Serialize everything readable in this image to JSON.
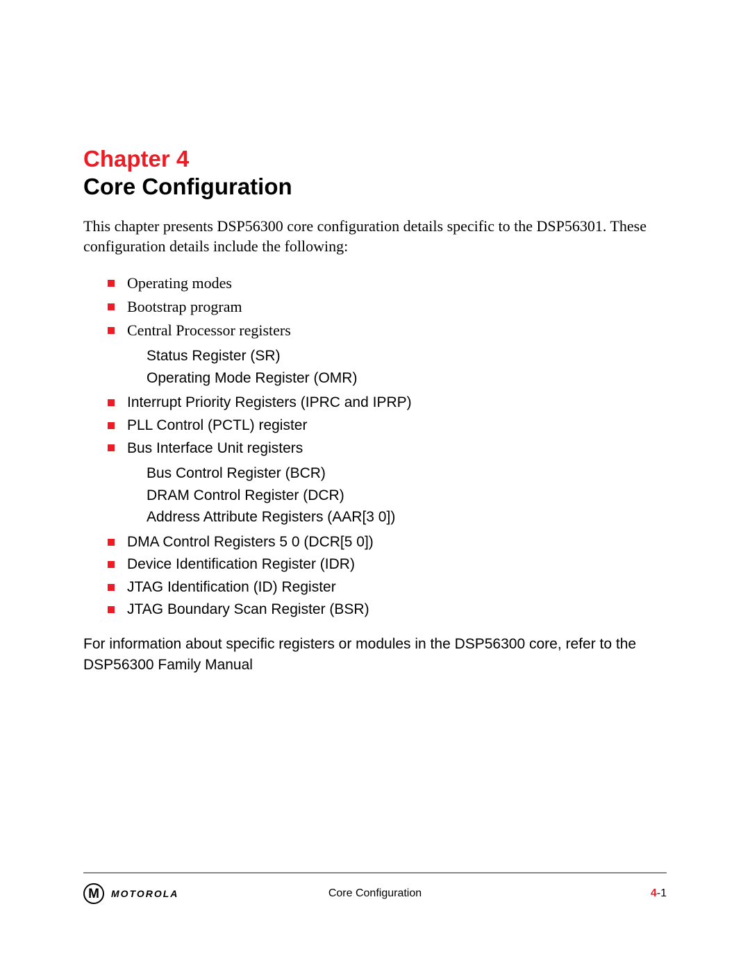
{
  "header": {
    "chapter_label": "Chapter 4",
    "chapter_title": "Core Configuration"
  },
  "intro": "This chapter presents DSP56300 core configuration details specific to the DSP56301. These configuration details include the following:",
  "bullets": [
    {
      "text": "Operating modes",
      "style": "serif",
      "sub": []
    },
    {
      "text": "Bootstrap program",
      "style": "serif",
      "sub": []
    },
    {
      "text": "Central Processor registers",
      "style": "serif",
      "sub": [
        "Status Register (SR)",
        "Operating Mode Register (OMR)"
      ]
    },
    {
      "text": "Interrupt Priority Registers (IPRC and IPRP)",
      "style": "sans",
      "sub": []
    },
    {
      "text": "PLL Control (PCTL) register",
      "style": "sans",
      "sub": []
    },
    {
      "text": "Bus Interface Unit registers",
      "style": "sans",
      "sub": [
        "Bus Control Register (BCR)",
        "DRAM Control Register (DCR)",
        "Address Attribute Registers (AAR[3 0])"
      ]
    },
    {
      "text": "DMA Control Registers 5 0 (DCR[5 0])",
      "style": "sans",
      "sub": []
    },
    {
      "text": "Device Identification Register (IDR)",
      "style": "sans",
      "sub": []
    },
    {
      "text": "JTAG Identification (ID) Register",
      "style": "sans",
      "sub": []
    },
    {
      "text": "JTAG Boundary Scan Register (BSR)",
      "style": "sans",
      "sub": []
    }
  ],
  "closing": "For information about specific registers or modules in the DSP56300 core, refer to the DSP56300 Family Manual",
  "footer": {
    "logo_letter": "M",
    "brand": "MOTOROLA",
    "center": "Core Configuration",
    "page_chapter": "4",
    "page_sep": "-",
    "page_num": "1"
  }
}
